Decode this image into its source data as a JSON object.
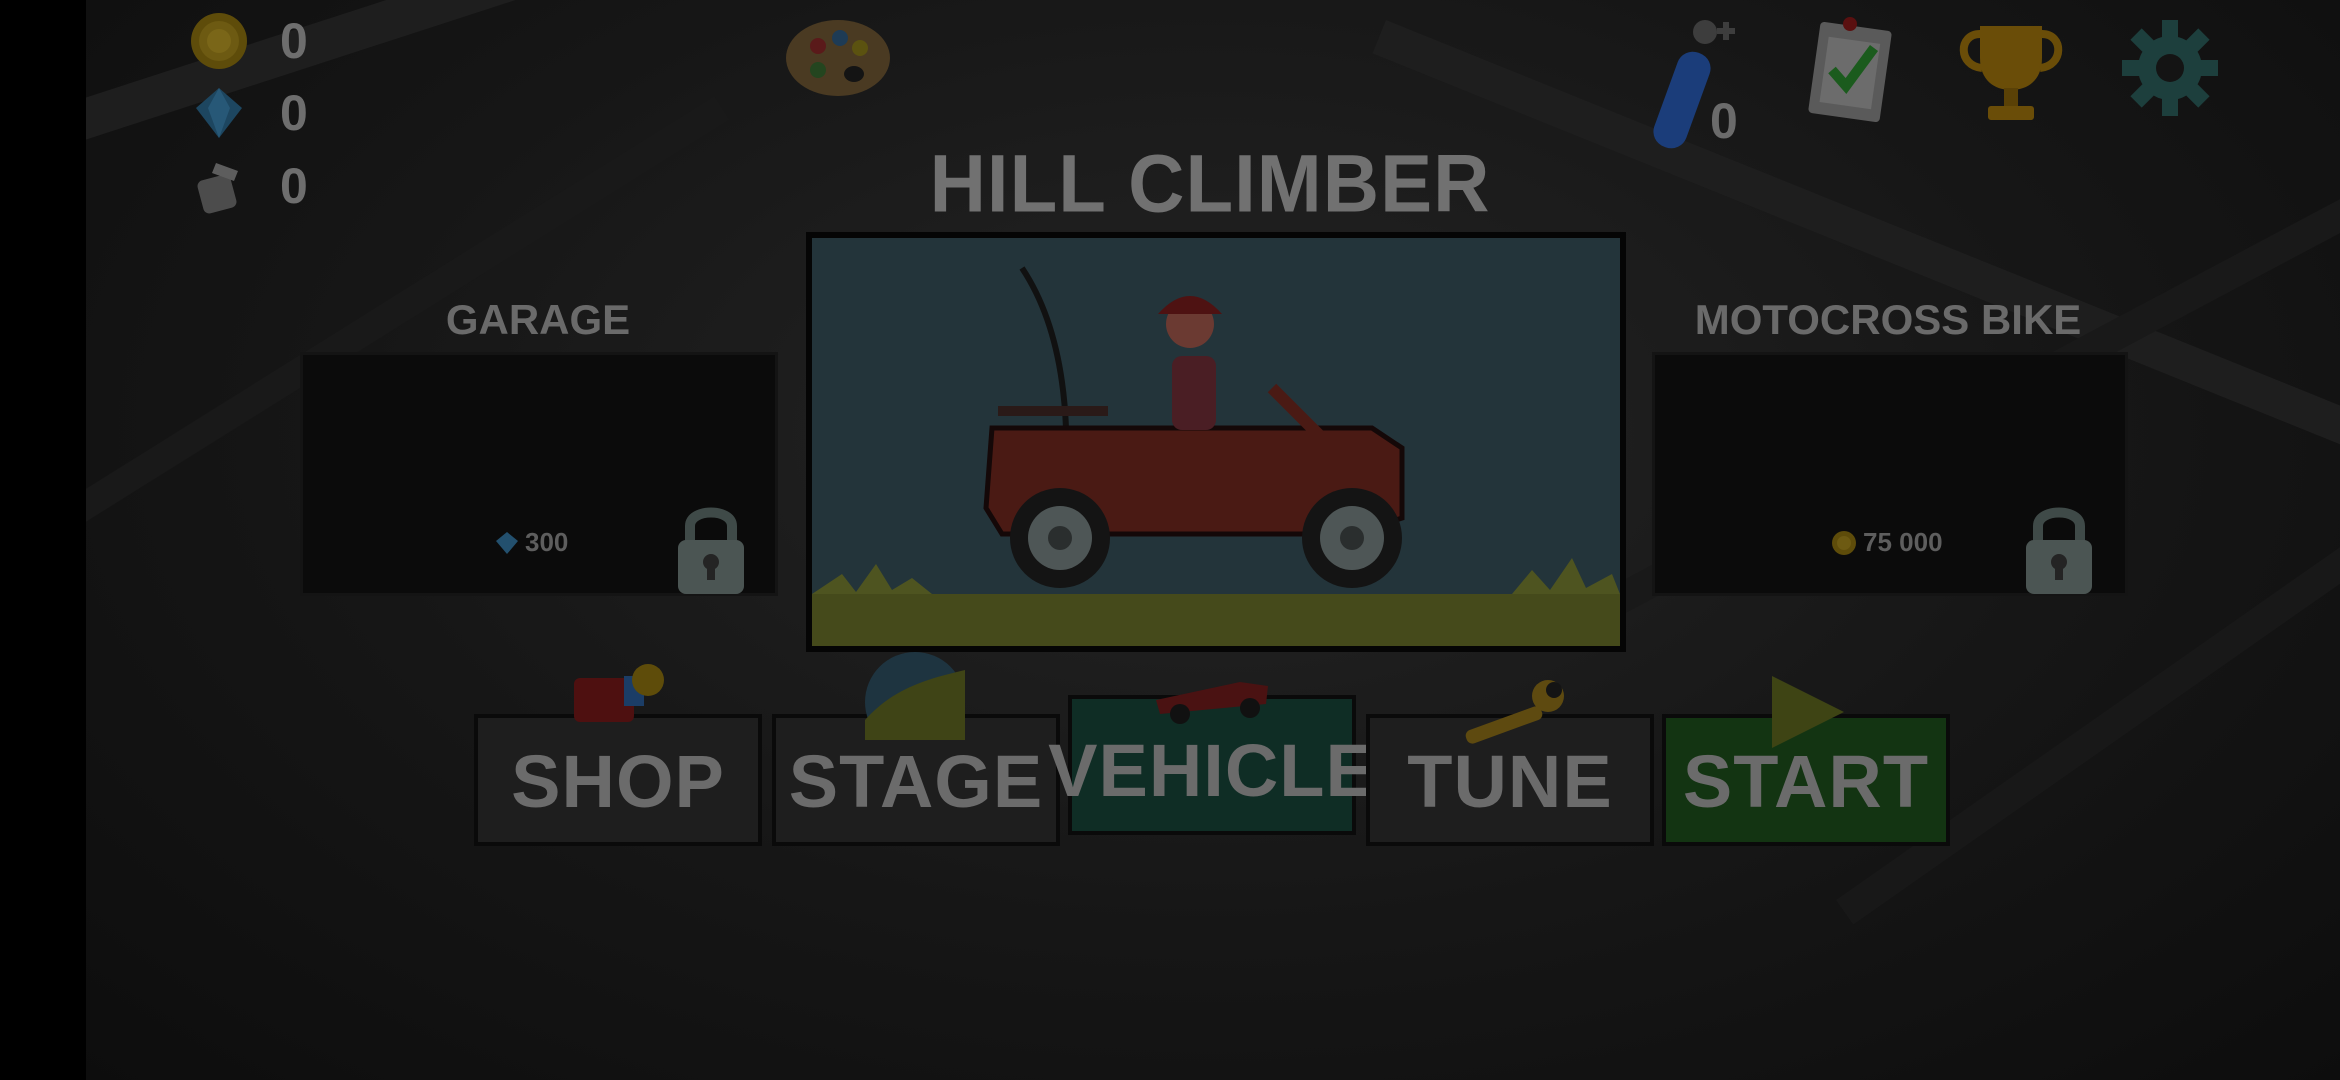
{
  "currencies": [
    {
      "icon": "coin-icon",
      "value": "0"
    },
    {
      "icon": "diamond-icon",
      "value": "0"
    },
    {
      "icon": "fuel-can-icon",
      "value": "0"
    }
  ],
  "title": "HILL CLIMBER",
  "fuel": {
    "value": "0"
  },
  "vehicles": {
    "left": {
      "label": "GARAGE",
      "price": "300",
      "price_icon": "diamond-icon",
      "locked": true
    },
    "right": {
      "label": "MOTOCROSS BIKE",
      "price": "75 000",
      "price_icon": "coin-icon",
      "locked": true
    }
  },
  "nav": {
    "shop": "SHOP",
    "stage": "STAGE",
    "vehicle": "VEHICLE",
    "tune": "TUNE",
    "start": "START"
  },
  "colors": {
    "active_tab": "#0f2d25",
    "start_button": "#133412",
    "accent_gold": "#7a6a10"
  }
}
